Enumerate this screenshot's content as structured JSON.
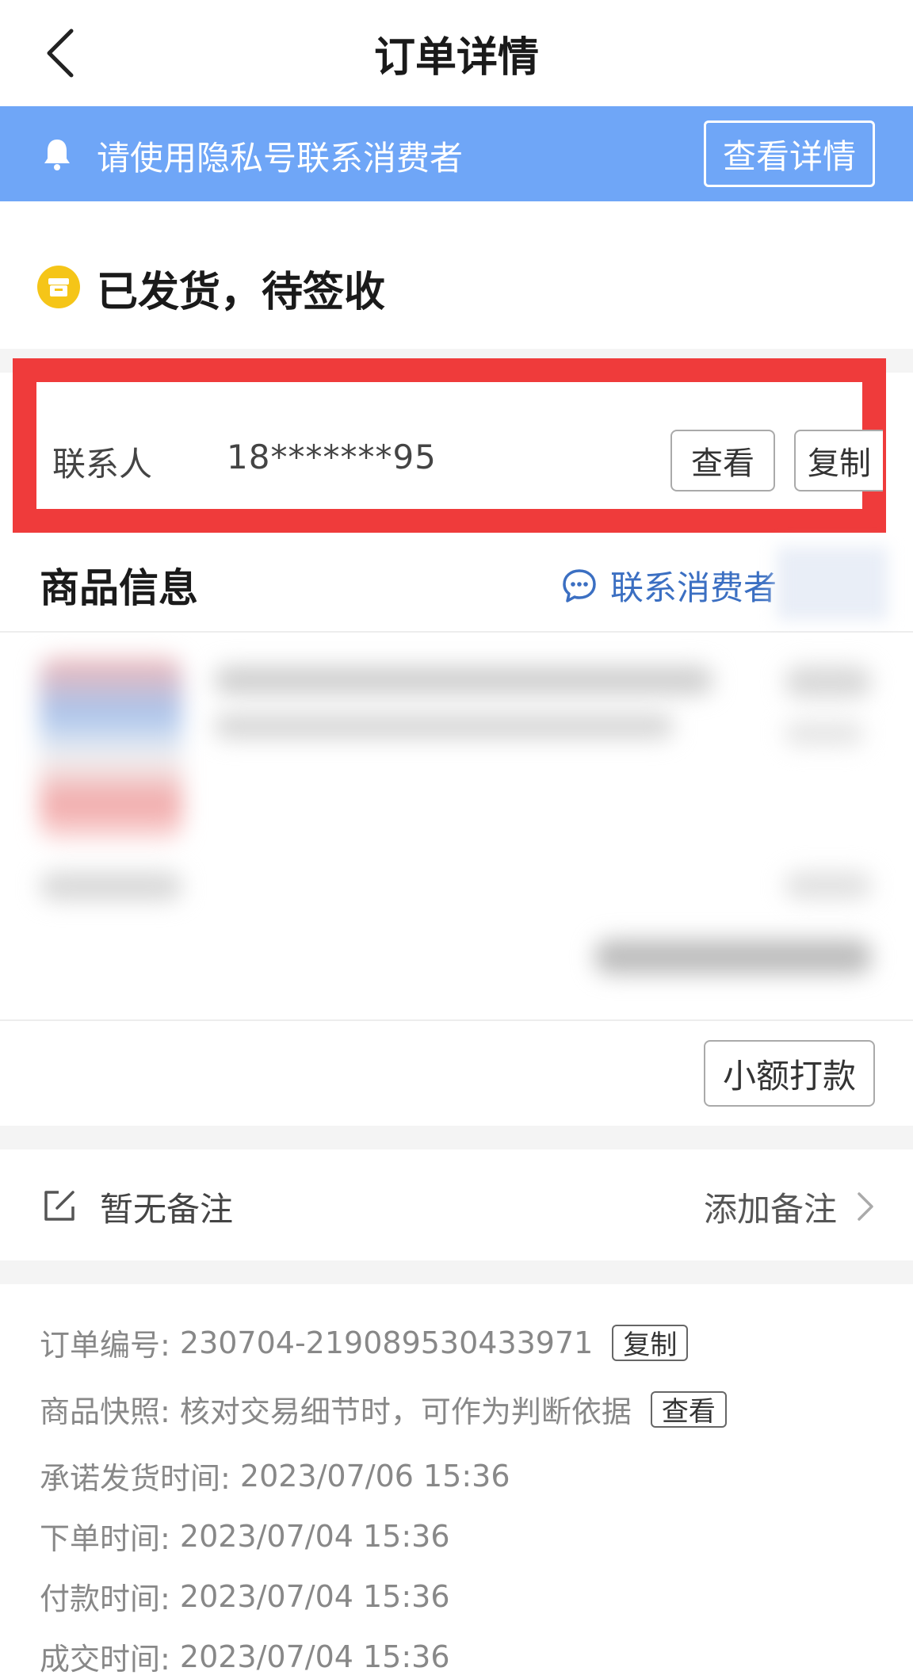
{
  "header": {
    "title": "订单详情",
    "back_icon": "chevron-left-icon"
  },
  "notice": {
    "icon": "bell-icon",
    "text": "请使用隐私号联系消费者",
    "button": "查看详情",
    "bg_color": "#6fa6f7"
  },
  "status": {
    "icon": "package-box-icon",
    "text": "已发货，待签收",
    "icon_color": "#f5c518"
  },
  "contact": {
    "label": "联系人",
    "phone": "18*******95",
    "view_button": "查看",
    "copy_button": "复制",
    "highlight_color": "#ef3b3b"
  },
  "goods": {
    "title": "商品信息",
    "contact_consumer": "联系消费者",
    "chat_icon": "chat-bubble-icon"
  },
  "actions": {
    "small_transfer": "小额打款"
  },
  "remark": {
    "icon": "edit-icon",
    "text": "暂无备注",
    "add": "添加备注",
    "chevron": "chevron-right-icon"
  },
  "order_info": {
    "order_no_label": "订单编号:",
    "order_no": "230704-219089530433971",
    "order_no_copy": "复制",
    "snapshot_label": "商品快照:",
    "snapshot_text": "核对交易细节时，可作为判断依据",
    "snapshot_view": "查看",
    "promise_ship_label": "承诺发货时间:",
    "promise_ship_time": "2023/07/06 15:36",
    "order_time_label": "下单时间:",
    "order_time": "2023/07/04 15:36",
    "pay_time_label": "付款时间:",
    "pay_time": "2023/07/04 15:36",
    "deal_time_label": "成交时间:",
    "deal_time": "2023/07/04 15:36"
  }
}
